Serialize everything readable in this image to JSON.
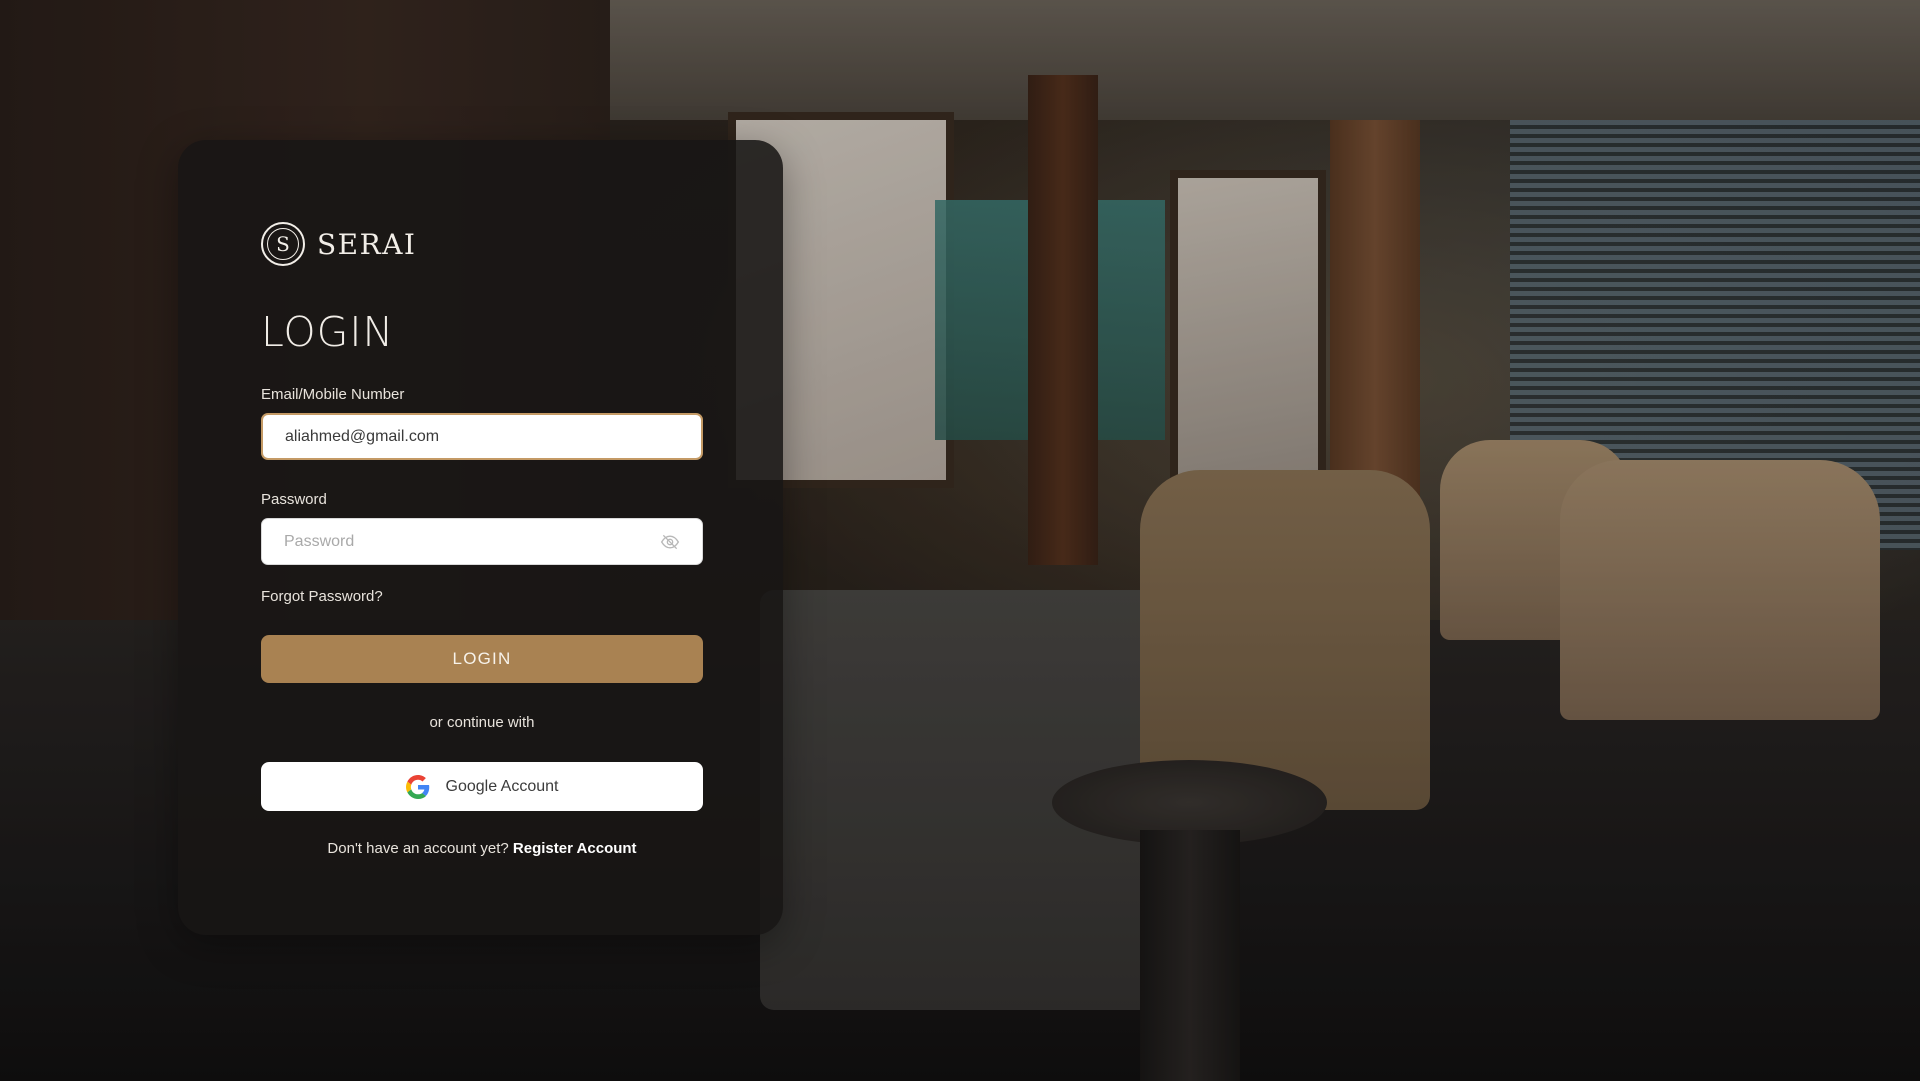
{
  "brand": {
    "logo_letter": "S",
    "name": "SERAI"
  },
  "login": {
    "title": "LOGIN",
    "email_label": "Email/Mobile Number",
    "email_value": "aliahmed@gmail.com",
    "password_label": "Password",
    "password_placeholder": "Password",
    "password_toggle_icon": "eye-off-icon",
    "forgot_password": "Forgot Password?",
    "submit_label": "LOGIN",
    "divider_text": "or continue with",
    "google_label": "Google Account",
    "google_icon": "google-icon",
    "register_prompt": "Don't have an account yet?",
    "register_link": "Register Account"
  },
  "colors": {
    "accent": "#a98252",
    "focus_border": "#c49a65",
    "card_bg": "rgba(24,22,21,0.88)"
  }
}
